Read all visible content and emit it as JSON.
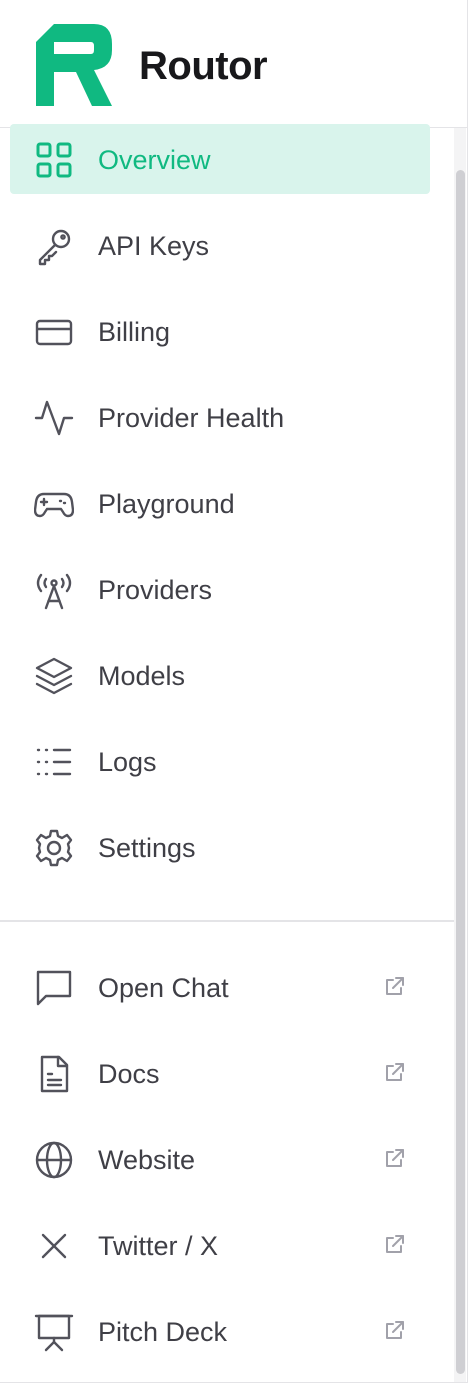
{
  "brand": {
    "name": "Routor",
    "color": "#10b981"
  },
  "nav": [
    {
      "label": "Overview",
      "icon": "grid-icon",
      "active": true
    },
    {
      "label": "API Keys",
      "icon": "key-icon"
    },
    {
      "label": "Billing",
      "icon": "credit-card-icon"
    },
    {
      "label": "Provider Health",
      "icon": "activity-icon"
    },
    {
      "label": "Playground",
      "icon": "gamepad-icon"
    },
    {
      "label": "Providers",
      "icon": "radio-tower-icon"
    },
    {
      "label": "Models",
      "icon": "layers-icon"
    },
    {
      "label": "Logs",
      "icon": "list-icon"
    },
    {
      "label": "Settings",
      "icon": "gear-icon"
    }
  ],
  "external": [
    {
      "label": "Open Chat",
      "icon": "chat-icon"
    },
    {
      "label": "Docs",
      "icon": "document-icon"
    },
    {
      "label": "Website",
      "icon": "globe-icon"
    },
    {
      "label": "Twitter / X",
      "icon": "x-icon"
    },
    {
      "label": "Pitch Deck",
      "icon": "presentation-icon"
    }
  ],
  "colors": {
    "active_bg": "#d9f4ec",
    "active_text": "#10b981",
    "text": "#3f3f46",
    "border": "#e4e4e7"
  }
}
